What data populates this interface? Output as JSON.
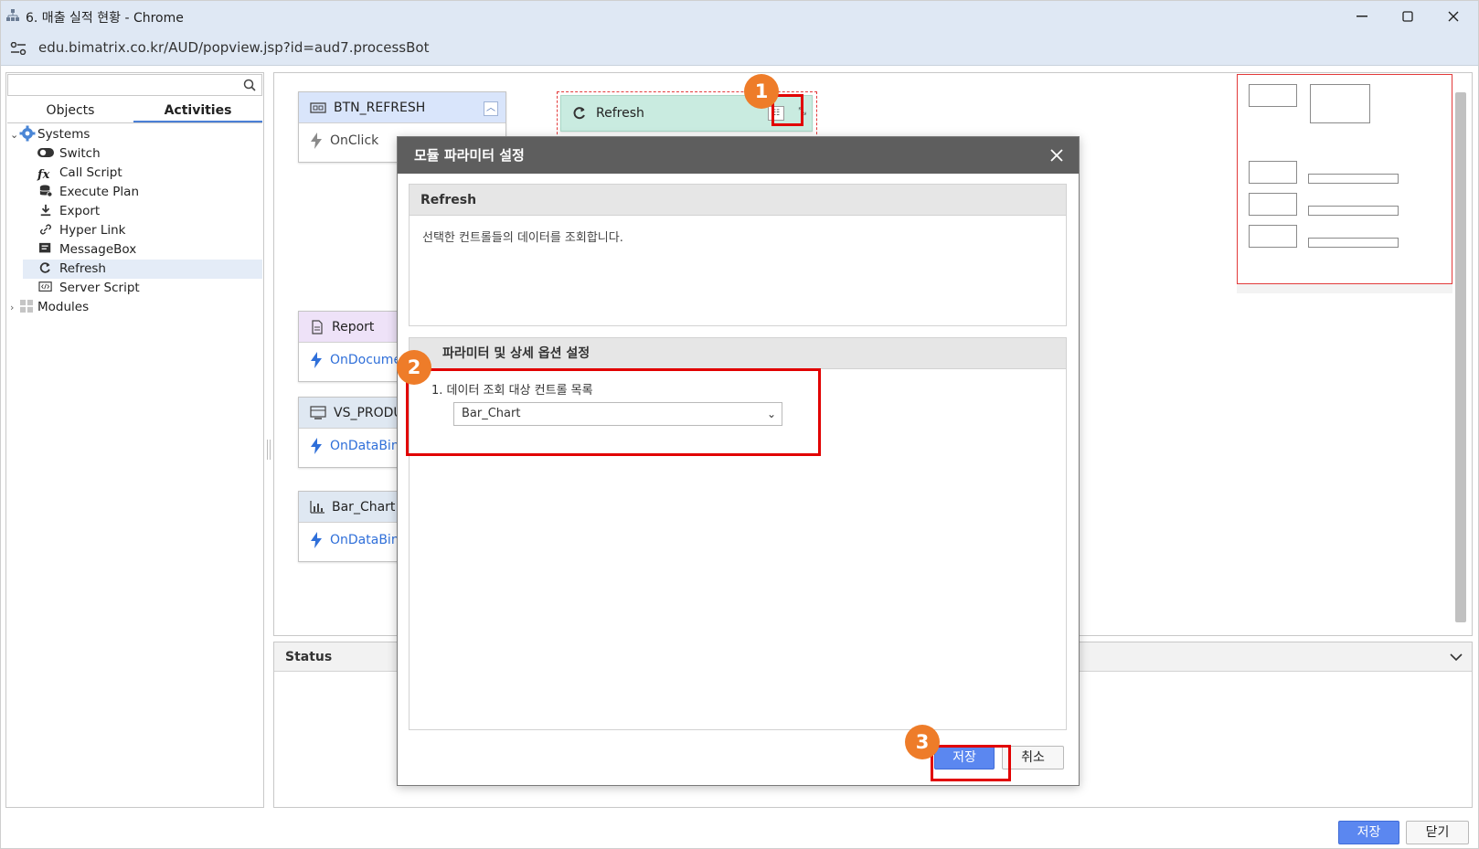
{
  "window": {
    "title": "6. 매출 실적 현황 - Chrome",
    "url": "edu.bimatrix.co.kr/AUD/popview.jsp?id=aud7.processBot"
  },
  "left_panel": {
    "search": {
      "placeholder": "",
      "value": ""
    },
    "tabs": [
      "Objects",
      "Activities"
    ],
    "active_tab": "Activities",
    "tree": {
      "systems_label": "Systems",
      "items": [
        "Switch",
        "Call Script",
        "Execute Plan",
        "Export",
        "Hyper Link",
        "MessageBox",
        "Refresh",
        "Server Script"
      ],
      "selected": "Refresh",
      "modules_label": "Modules"
    }
  },
  "canvas": {
    "nodes": [
      {
        "title": "BTN_REFRESH",
        "event": "OnClick"
      },
      {
        "title": "Report",
        "event": "OnDocume"
      },
      {
        "title": "VS_PRODU",
        "event": "OnDataBinc"
      },
      {
        "title": "Bar_Chart",
        "event": "OnDataBinc"
      },
      {
        "title": "Refresh",
        "event": ""
      }
    ]
  },
  "status": {
    "label": "Status"
  },
  "dialog": {
    "title": "모듈 파라미터 설정",
    "section1_title": "Refresh",
    "description": "선택한 컨트롤들의 데이터를 조회합니다.",
    "section2_title": "파라미터 및 상세 옵션 설정",
    "param_label": "1. 데이터 조회 대상 컨트롤 목록",
    "param_value": "Bar_Chart",
    "save_label": "저장",
    "cancel_label": "취소"
  },
  "annotations": {
    "markers": [
      "1",
      "2",
      "3"
    ],
    "marker_color": "#ee7c29",
    "highlight_color": "#e10000"
  },
  "footer": {
    "save_label": "저장",
    "close_label": "닫기"
  },
  "colors": {
    "accent": "#5b87f0",
    "titlebar": "#dfe8f4",
    "dialog_header": "#5e5e5e"
  }
}
